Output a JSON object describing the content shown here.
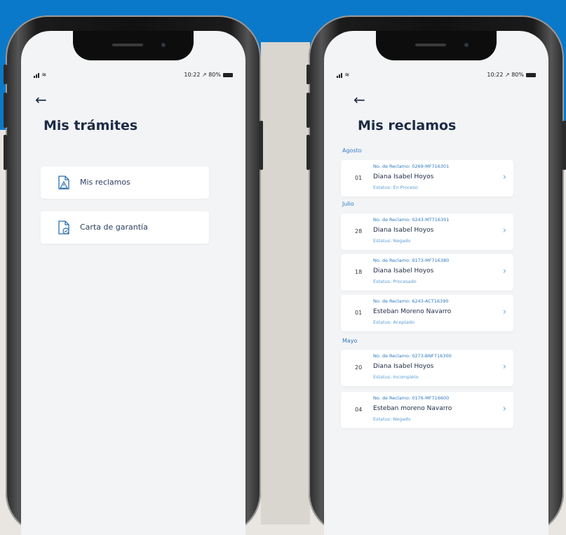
{
  "status_bar": {
    "time": "10:22",
    "battery": "80%",
    "location_arrow": "↗"
  },
  "left_screen": {
    "back_icon": "arrow-left",
    "title": "Mis trámites",
    "menu": [
      {
        "label": "Mis reclamos",
        "icon": "document-warning"
      },
      {
        "label": "Carta de garantía",
        "icon": "document-check"
      }
    ]
  },
  "right_screen": {
    "back_icon": "arrow-left",
    "title": "Mis reclamos",
    "groups": [
      {
        "month": "Agosto"
      },
      {
        "month": "Julio"
      },
      {
        "month": "Mayo"
      }
    ],
    "claims": [
      {
        "day": "01",
        "number": "No. de Reclamo: 0269-MF716301",
        "name": "Diana Isabel Hoyos",
        "status": "Estatus: En Proceso"
      },
      {
        "day": "28",
        "number": "No. de Reclamo: 0243-MT716301",
        "name": "Diana Isabel Hoyos",
        "status": "Estatus: Negado"
      },
      {
        "day": "18",
        "number": "No. de Reclamo: 9173-MF716380",
        "name": "Diana Isabel Hoyos",
        "status": "Estatus: Procesado"
      },
      {
        "day": "01",
        "number": "No. de Reclamo: 6243-ACT16390",
        "name": "Esteban Moreno Navarro",
        "status": "Estatus: Aceptado"
      },
      {
        "day": "20",
        "number": "No. de Reclamo: 0273-BNF716300",
        "name": "Diana Isabel Hoyos",
        "status": "Estatus: Incompleto"
      },
      {
        "day": "04",
        "number": "No. de Reclamo: 0176-MF716600",
        "name": "Esteban moreno Navarro",
        "status": "Estatus: Negado"
      }
    ]
  },
  "colors": {
    "background_blue": "#0b79c9",
    "title": "#1d2b45",
    "accent": "#2e7ac2"
  }
}
